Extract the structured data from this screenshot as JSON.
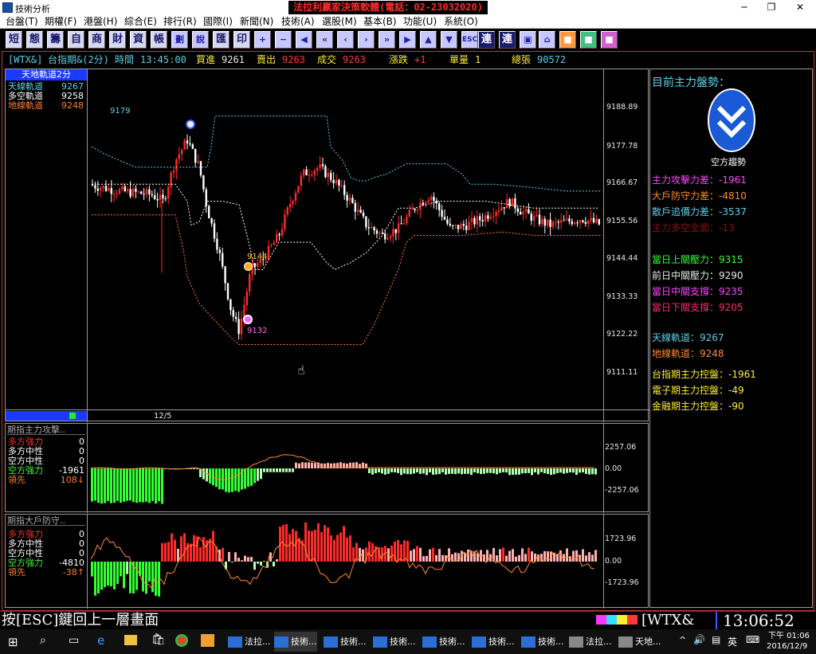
{
  "window": {
    "app_title": "技術分析",
    "banner": "法拉利贏家決策軟體(電話：02-23032020)"
  },
  "menu": [
    "台盤(T)",
    "期權(F)",
    "港盤(H)",
    "綜合(E)",
    "排行(R)",
    "國際(I)",
    "新聞(N)",
    "技術(A)",
    "選股(M)",
    "基本(B)",
    "功能(U)",
    "系統(O)"
  ],
  "toolbar": {
    "text_buttons": [
      "短",
      "態",
      "籌",
      "自",
      "商",
      "財",
      "資",
      "帳",
      "劃",
      "說",
      "匯",
      "印"
    ],
    "right_buttons": [
      "連",
      "連"
    ]
  },
  "quote": {
    "symbol": "[WTX&]",
    "name": "台指期&(2分)",
    "time_label": "時間",
    "time": "13:45:00",
    "bid_label": "買進",
    "bid": "9261",
    "ask_label": "賣出",
    "ask": "9263",
    "last_label": "成交",
    "last": "9263",
    "change_label": "漲跌",
    "change": "+1",
    "vol_label": "單量",
    "vol": "1",
    "total_label": "總張",
    "total": "90572"
  },
  "main_chart": {
    "tab_label": "天地軌道2分",
    "legend": [
      {
        "label": "天線軌道",
        "value": "9267",
        "color": "#5dd0e8"
      },
      {
        "label": "多空軌道",
        "value": "9258",
        "color": "#ffffff"
      },
      {
        "label": "地線軌道",
        "value": "9248",
        "color": "#ff7a2a"
      }
    ],
    "date_label": "12/5",
    "y_ticks": [
      "9188.89",
      "9177.78",
      "9166.67",
      "9155.56",
      "9144.44",
      "9133.33",
      "9122.22",
      "9111.11"
    ],
    "annotations": [
      {
        "text": "9179",
        "color": "#5dd0e8"
      },
      {
        "text": "9144",
        "color": "#ffcc33"
      },
      {
        "text": "9132",
        "color": "#ff66ff"
      }
    ]
  },
  "panel1": {
    "title": "期指主力攻擊..",
    "legend": [
      {
        "label": "多方強力",
        "value": "0",
        "color": "#ff2a2a"
      },
      {
        "label": "多方中性",
        "value": "0",
        "color": "#ffffff"
      },
      {
        "label": "空方中性",
        "value": "0",
        "color": "#ffffff"
      },
      {
        "label": "空方強力",
        "value": "-1961",
        "color": "#33ff33"
      },
      {
        "label": "領先",
        "value": "108↓",
        "color": "#ff7a2a"
      }
    ],
    "y_ticks": [
      "2257.06",
      "0.00",
      "-2257.06"
    ]
  },
  "panel2": {
    "title": "期指大戶防守..",
    "legend": [
      {
        "label": "多方強力",
        "value": "0",
        "color": "#ff2a2a"
      },
      {
        "label": "多方中性",
        "value": "0",
        "color": "#ffffff"
      },
      {
        "label": "空方中性",
        "value": "0",
        "color": "#ffffff"
      },
      {
        "label": "空方強力",
        "value": "-4810",
        "color": "#33ff33"
      },
      {
        "label": "領先",
        "value": "-38↑",
        "color": "#ff7a2a"
      }
    ],
    "y_ticks": [
      "1723.96",
      "0.00",
      "-1723.96"
    ]
  },
  "right_panel": {
    "heading": "目前主力盤勢：",
    "trend_label": "空方趨勢",
    "rows": [
      {
        "text": "主力攻擊力差：-1961",
        "color": "#ff44ff"
      },
      {
        "text": "大戶防守力差：-4810",
        "color": "#ff8a2a"
      },
      {
        "text": "散戶追價力差：-3537",
        "color": "#5dd0e8"
      },
      {
        "text": "主力多空全面：-13",
        "color": "#8b1010"
      },
      {
        "text": "當日上關壓力：9315",
        "color": "#33ff33"
      },
      {
        "text": "前日中關壓力：9290",
        "color": "#e8e8e8"
      },
      {
        "text": "當日中關支撐：9235",
        "color": "#ff44ff"
      },
      {
        "text": "當日下關支撐：9205",
        "color": "#ff2a6a"
      },
      {
        "text": "天線軌道：9267",
        "color": "#5dd0e8"
      },
      {
        "text": "地線軌道：9248",
        "color": "#ff8a2a"
      },
      {
        "text": "台指期主力控盤：-1961",
        "color": "#ffee33"
      },
      {
        "text": "電子期主力控盤：-49",
        "color": "#ffee33"
      },
      {
        "text": "金融期主力控盤：-90",
        "color": "#ffee33"
      }
    ]
  },
  "status": {
    "hint": "按[ESC]鍵回上一層畫面",
    "symbol": "[WTX&",
    "clock": "13:06:52"
  },
  "taskbar": {
    "items": [
      "法拉...",
      "技術...",
      "技術...",
      "技術...",
      "技術...",
      "技術...",
      "技術...",
      "法拉...",
      "天地..."
    ],
    "ime": "英",
    "time": "下午 01:06",
    "date": "2016/12/9"
  },
  "colors": {
    "up": "#ff2a2a",
    "down": "#ffffff",
    "sky_band": "#5dd0e8",
    "mid_band": "#ffffff",
    "ground_band": "#ff7a2a",
    "bull_bar": "#ff2a2a",
    "bear_bar": "#33ff33"
  }
}
